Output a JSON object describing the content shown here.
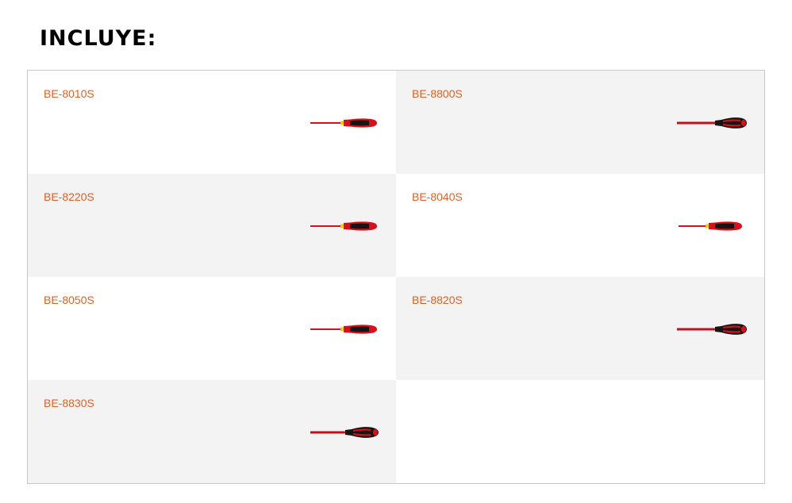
{
  "heading": "INCLUYE:",
  "colors": {
    "code_text": "#d9622b",
    "shaded_cell": "#f3f3f3",
    "tool_red": "#d8101c",
    "tool_black": "#151515",
    "tool_yellow": "#f2d000"
  },
  "products": [
    {
      "code": "BE-8010S",
      "icon": "screwdriver-icon"
    },
    {
      "code": "BE-8800S",
      "icon": "screwdriver-icon"
    },
    {
      "code": "BE-8220S",
      "icon": "screwdriver-icon"
    },
    {
      "code": "BE-8040S",
      "icon": "screwdriver-icon"
    },
    {
      "code": "BE-8050S",
      "icon": "screwdriver-icon"
    },
    {
      "code": "BE-8820S",
      "icon": "screwdriver-icon"
    },
    {
      "code": "BE-8830S",
      "icon": "screwdriver-icon"
    }
  ]
}
